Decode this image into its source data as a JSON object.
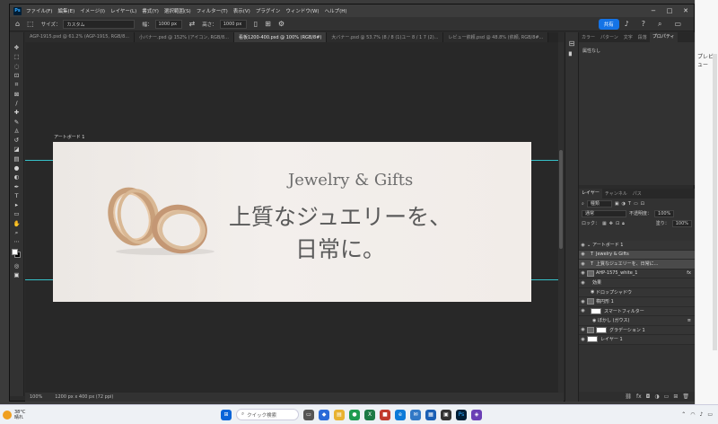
{
  "menu": {
    "items": [
      "ファイル(F)",
      "編集(E)",
      "イメージ(I)",
      "レイヤー(L)",
      "書式(Y)",
      "選択範囲(S)",
      "フィルター(T)",
      "表示(V)",
      "プラグイン",
      "ウィンドウ(W)",
      "ヘルプ(H)"
    ]
  },
  "options": {
    "size_label": "サイズ：",
    "size_value": "カスタム",
    "width_label": "幅：",
    "width_value": "1000 px",
    "height_label": "高さ：",
    "height_value": "1000 px",
    "share_label": "共有"
  },
  "tabs": [
    "AGP-1915.psd @ 61.2% (AGP-1915, RGB/8...",
    "小バナー.psd @ 152% (アイコン, RGB/8...",
    "看板1200-400.psd @ 100% (RGB/8#)",
    "大バナー.psd @ 53.7% (8 / 8 (1)ユー 8 / 1 7 (2)...",
    "レビュー依頼.psd @ 48.8% (依頼, RGB/8#..."
  ],
  "canvas": {
    "artboard_label": "アートボード 1",
    "brand_text": "Jewelry & Gifts",
    "headline_line1": "上質なジュエリーを、",
    "headline_line2": "日常に。"
  },
  "status": {
    "zoom": "100%",
    "doc_size": "1200 px x 400 px (72 ppi)"
  },
  "properties_panel": {
    "tabs": [
      "カラー",
      "パターン",
      "文字",
      "段落",
      "プロパティ"
    ],
    "body_text": "属性なし"
  },
  "layers_panel": {
    "tabs": [
      "レイヤー",
      "チャンネル",
      "パス"
    ],
    "filter_label": "種類",
    "blend_mode": "通常",
    "opacity_label": "不透明度：",
    "opacity_value": "100%",
    "lock_label": "ロック：",
    "fill_label": "塗り：",
    "fill_value": "100%",
    "layers": [
      {
        "name": "アートボード 1",
        "type": "artboard"
      },
      {
        "name": "Jewelry & Gifts",
        "type": "text"
      },
      {
        "name": "上質なジュエリーを、日常に...",
        "type": "text"
      },
      {
        "name": "AHP-1575_white_1",
        "type": "smart",
        "badge": "fx"
      },
      {
        "name": "効果",
        "type": "effects"
      },
      {
        "name": "ドロップシャドウ",
        "type": "effect"
      },
      {
        "name": "楕円形 1",
        "type": "shape"
      },
      {
        "name": "スマートフィルター",
        "type": "filter"
      },
      {
        "name": "ぼかし (ガウス)",
        "type": "filter-item"
      },
      {
        "name": "グラデーション 1",
        "type": "fill"
      },
      {
        "name": "レイヤー 1",
        "type": "pixel"
      }
    ]
  },
  "side_window": {
    "preview_label": "プレビュー"
  },
  "taskbar": {
    "temperature": "38°C",
    "weather": "晴れ",
    "search_placeholder": "クイック検索"
  }
}
